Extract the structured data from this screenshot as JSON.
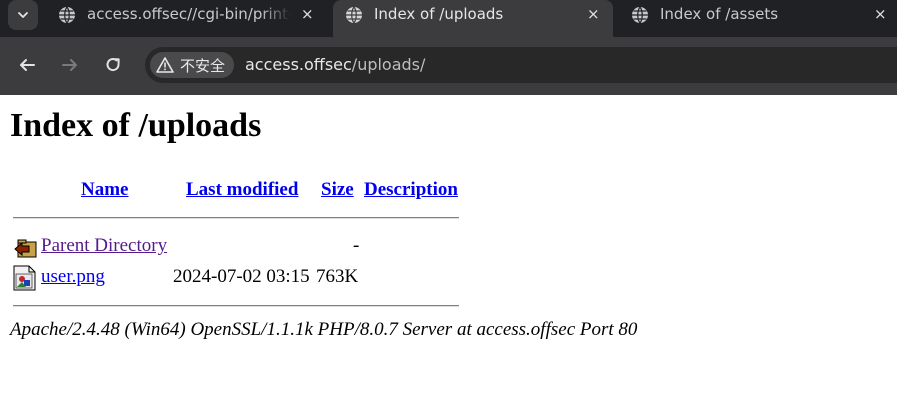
{
  "browser": {
    "tabs": [
      {
        "title": "access.offsec//cgi-bin/printenv.pl",
        "active": false,
        "close": "×"
      },
      {
        "title": "Index of /uploads",
        "active": true,
        "close": "×"
      },
      {
        "title": "Index of /assets",
        "active": false,
        "close": "×"
      }
    ],
    "security_label": "不安全",
    "url_host": "access.offsec",
    "url_path": "/uploads/"
  },
  "page": {
    "heading": "Index of /uploads",
    "columns": {
      "name": "Name",
      "last_modified": "Last modified",
      "size": "Size",
      "description": "Description"
    },
    "rows": [
      {
        "icon": "back-folder-icon",
        "name": "Parent Directory",
        "last_modified": "",
        "size": "-",
        "description": ""
      },
      {
        "icon": "image-file-icon",
        "name": "user.png",
        "last_modified": "2024-07-02 03:15",
        "size": "763K",
        "description": ""
      }
    ],
    "footer": "Apache/2.4.48 (Win64) OpenSSL/1.1.1k PHP/8.0.7 Server at access.offsec Port 80"
  }
}
